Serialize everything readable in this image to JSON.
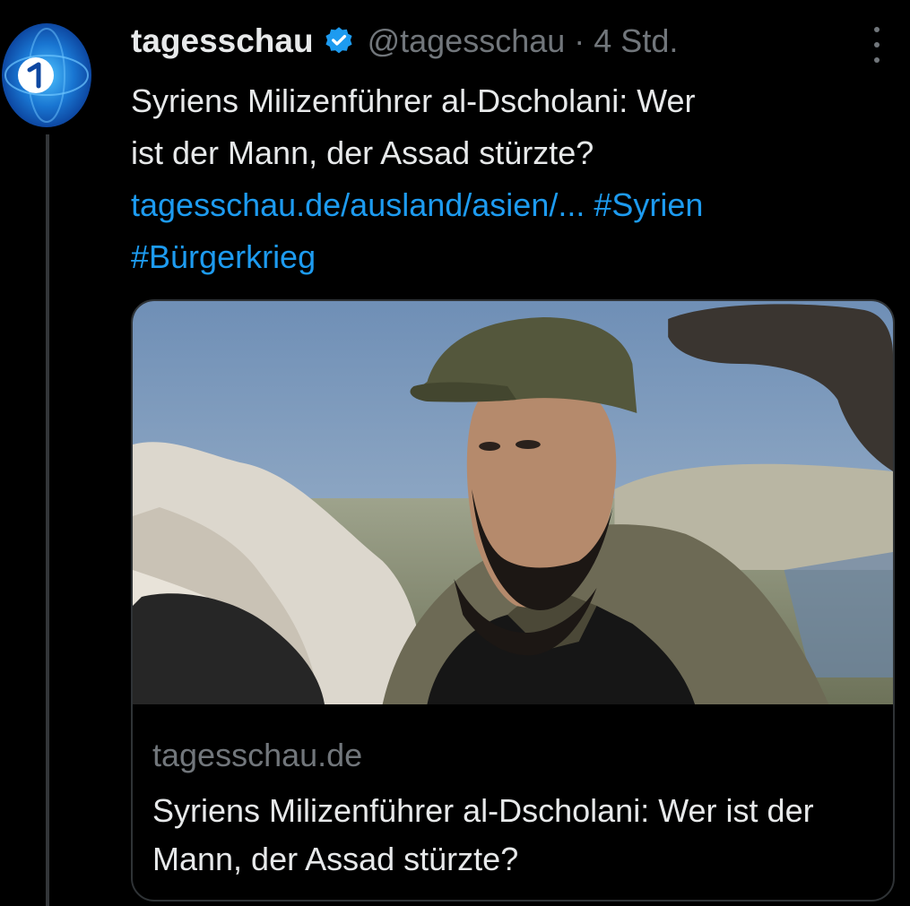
{
  "tweet": {
    "display_name": "tagesschau",
    "verified_icon": "verified-badge-icon",
    "handle": "@tagesschau",
    "separator": "·",
    "time": "4 Std.",
    "text_line1": "Syriens Milizenführer al-Dscholani: Wer",
    "text_line2": "ist der Mann, der Assad stürzte?",
    "link": "tagesschau.de/ausland/asien/...",
    "hashtag1": "#Syrien",
    "hashtag2": "#Bürgerkrieg",
    "avatar_icon": "ard-logo-icon",
    "more_icon": "more-options-icon"
  },
  "card": {
    "domain": "tagesschau.de",
    "title": "Syriens Milizenführer al-Dscholani: Wer ist der Mann, der Assad stürzte?"
  },
  "colors": {
    "background": "#000000",
    "text": "#e7e9ea",
    "secondary_text": "#71767b",
    "link": "#1d9bf0",
    "border": "#2f3336",
    "avatar_blue": "#1565c0"
  }
}
